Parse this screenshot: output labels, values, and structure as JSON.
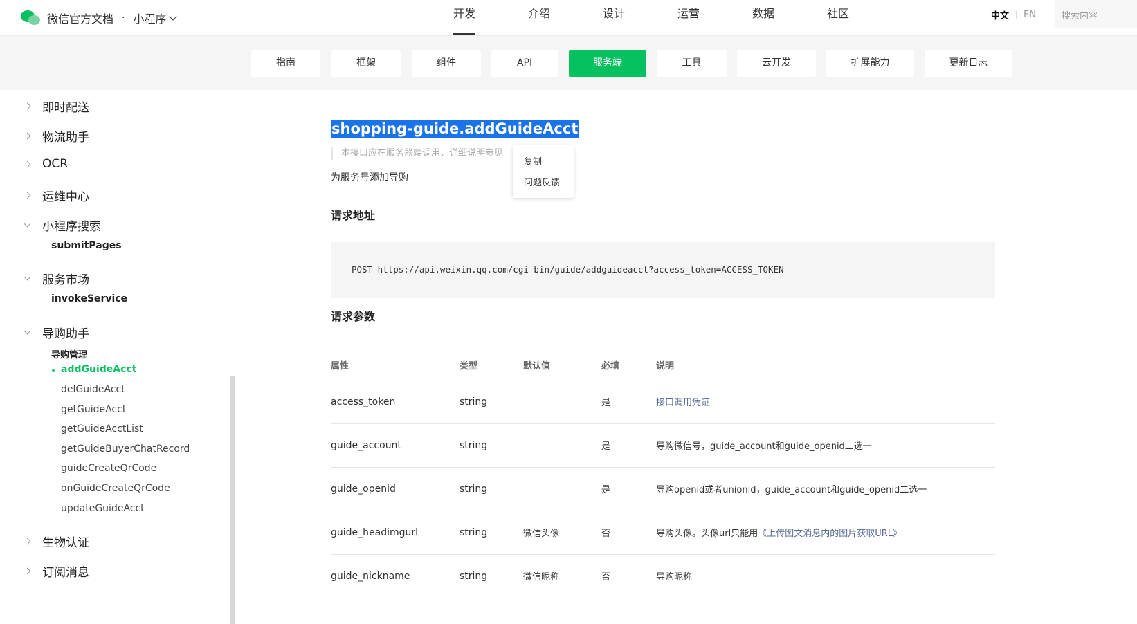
{
  "header": {
    "brand_title": "微信官方文档",
    "brand_separator": "·",
    "brand_sub": "小程序",
    "nav": [
      "开发",
      "介绍",
      "设计",
      "运营",
      "数据",
      "社区"
    ],
    "nav_active": "开发",
    "lang_zh": "中文",
    "lang_en": "EN",
    "search_placeholder": "搜索内容"
  },
  "subnav": {
    "tabs": [
      "指南",
      "框架",
      "组件",
      "API",
      "服务端",
      "工具",
      "云开发",
      "扩展能力",
      "更新日志"
    ],
    "active": "服务端"
  },
  "sidebar": {
    "groups": [
      {
        "label": "即时配送",
        "open": false
      },
      {
        "label": "物流助手",
        "open": false
      },
      {
        "label": "OCR",
        "open": false
      },
      {
        "label": "运维中心",
        "open": false
      },
      {
        "label": "小程序搜索",
        "open": true,
        "children": [
          "submitPages"
        ]
      },
      {
        "label": "服务市场",
        "open": true,
        "children": [
          "invokeService"
        ]
      },
      {
        "label": "导购助手",
        "open": true,
        "subheading": "导购管理",
        "items": [
          "addGuideAcct",
          "delGuideAcct",
          "getGuideAcct",
          "getGuideAcctList",
          "getGuideBuyerChatRecord",
          "guideCreateQrCode",
          "onGuideCreateQrCode",
          "updateGuideAcct"
        ],
        "active_item": "addGuideAcct"
      },
      {
        "label": "生物认证",
        "open": false
      },
      {
        "label": "订阅消息",
        "open": false
      }
    ]
  },
  "content": {
    "title": "shopping-guide.addGuideAcct",
    "note": "本接口应在服务器端调用，详细说明参见",
    "description": "为服务号添加导购",
    "request_url_heading": "请求地址",
    "request_url": "POST https://api.weixin.qq.com/cgi-bin/guide/addguideacct?access_token=ACCESS_TOKEN",
    "params_heading": "请求参数",
    "table": {
      "headers": [
        "属性",
        "类型",
        "默认值",
        "必填",
        "说明"
      ],
      "rows": [
        {
          "name": "access_token",
          "type": "string",
          "default": "",
          "required": "是",
          "desc": "接口调用凭证",
          "desc_link": true
        },
        {
          "name": "guide_account",
          "type": "string",
          "default": "",
          "required": "是",
          "desc": "导购微信号，guide_account和guide_openid二选一"
        },
        {
          "name": "guide_openid",
          "type": "string",
          "default": "",
          "required": "是",
          "desc": "导购openid或者unionid，guide_account和guide_openid二选一"
        },
        {
          "name": "guide_headimgurl",
          "type": "string",
          "default": "微信头像",
          "required": "否",
          "desc": "导购头像。头像url只能用",
          "desc_link_text": "《上传图文消息内的图片获取URL》"
        },
        {
          "name": "guide_nickname",
          "type": "string",
          "default": "微信昵称",
          "required": "否",
          "desc": "导购昵称"
        }
      ]
    }
  },
  "context_menu": {
    "items": [
      "复制",
      "问题反馈"
    ]
  },
  "colors": {
    "accent": "#07c160",
    "link": "#576b95",
    "selection": "#1a73e8"
  }
}
